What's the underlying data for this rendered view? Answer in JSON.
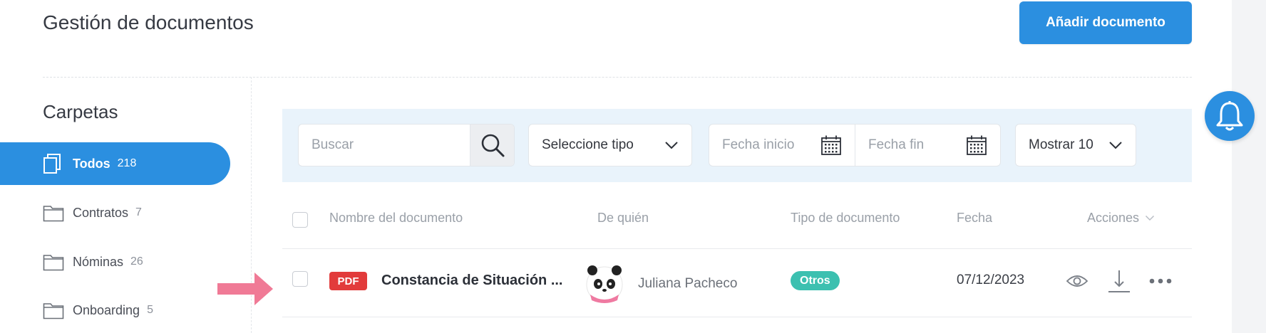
{
  "header": {
    "title": "Gestión de documentos",
    "add_button": "Añadir documento"
  },
  "sidebar": {
    "title": "Carpetas",
    "folders": [
      {
        "label": "Todos",
        "count": "218",
        "active": true
      },
      {
        "label": "Contratos",
        "count": "7"
      },
      {
        "label": "Nóminas",
        "count": "26"
      },
      {
        "label": "Onboarding",
        "count": "5"
      }
    ]
  },
  "filters": {
    "search_placeholder": "Buscar",
    "type_select": "Seleccione tipo",
    "date_start": "Fecha inicio",
    "date_end": "Fecha fin",
    "show": "Mostrar 10"
  },
  "table": {
    "headers": [
      "Nombre del documento",
      "De quién",
      "Tipo de documento",
      "Fecha",
      "Acciones"
    ],
    "rows": [
      {
        "badge": "PDF",
        "name": "Constancia de Situación ...",
        "author": "Juliana Pacheco",
        "type": "Otros",
        "date": "07/12/2023"
      }
    ]
  },
  "colors": {
    "primary": "#2b8fe0",
    "pdf_badge": "#e23b3b",
    "tag": "#3cc0b0",
    "arrow": "#f07a96",
    "filter_bar": "#e9f3fb"
  },
  "icons": {
    "search": "search-icon",
    "calendar": "calendar-icon",
    "chevron": "chevron-down-icon",
    "folder": "folder-icon",
    "documents": "documents-icon",
    "view": "eye-icon",
    "download": "download-icon",
    "more": "more-icon",
    "bell": "bell-icon"
  }
}
